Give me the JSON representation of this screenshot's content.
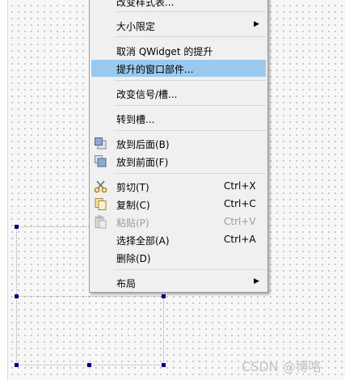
{
  "context_menu": {
    "items": [
      {
        "label": "改变样式表...",
        "shortcut": ""
      },
      {
        "label": "大小限定",
        "shortcut": "",
        "submenu": true
      },
      {
        "label": "取消 QWidget 的提升",
        "shortcut": ""
      },
      {
        "label": "提升的窗口部件...",
        "shortcut": "",
        "highlighted": true
      },
      {
        "label": "改变信号/槽...",
        "shortcut": ""
      },
      {
        "label": "转到槽...",
        "shortcut": ""
      },
      {
        "label": "放到后面(B)",
        "shortcut": "",
        "icon": "send-to-back-icon"
      },
      {
        "label": "放到前面(F)",
        "shortcut": "",
        "icon": "bring-to-front-icon"
      },
      {
        "label": "剪切(T)",
        "shortcut": "Ctrl+X",
        "icon": "scissors-icon"
      },
      {
        "label": "复制(C)",
        "shortcut": "Ctrl+C",
        "icon": "copy-icon"
      },
      {
        "label": "粘贴(P)",
        "shortcut": "Ctrl+V",
        "icon": "paste-icon",
        "disabled": true
      },
      {
        "label": "选择全部(A)",
        "shortcut": "Ctrl+A"
      },
      {
        "label": "删除(D)",
        "shortcut": ""
      },
      {
        "label": "布局",
        "shortcut": "",
        "submenu": true
      }
    ]
  },
  "watermark": "CSDN @博咯",
  "colors": {
    "menu_bg": "#f0f0f0",
    "highlight": "#99c9ef",
    "disabled_text": "#9b9b9b",
    "selection_handle": "#00007f"
  }
}
